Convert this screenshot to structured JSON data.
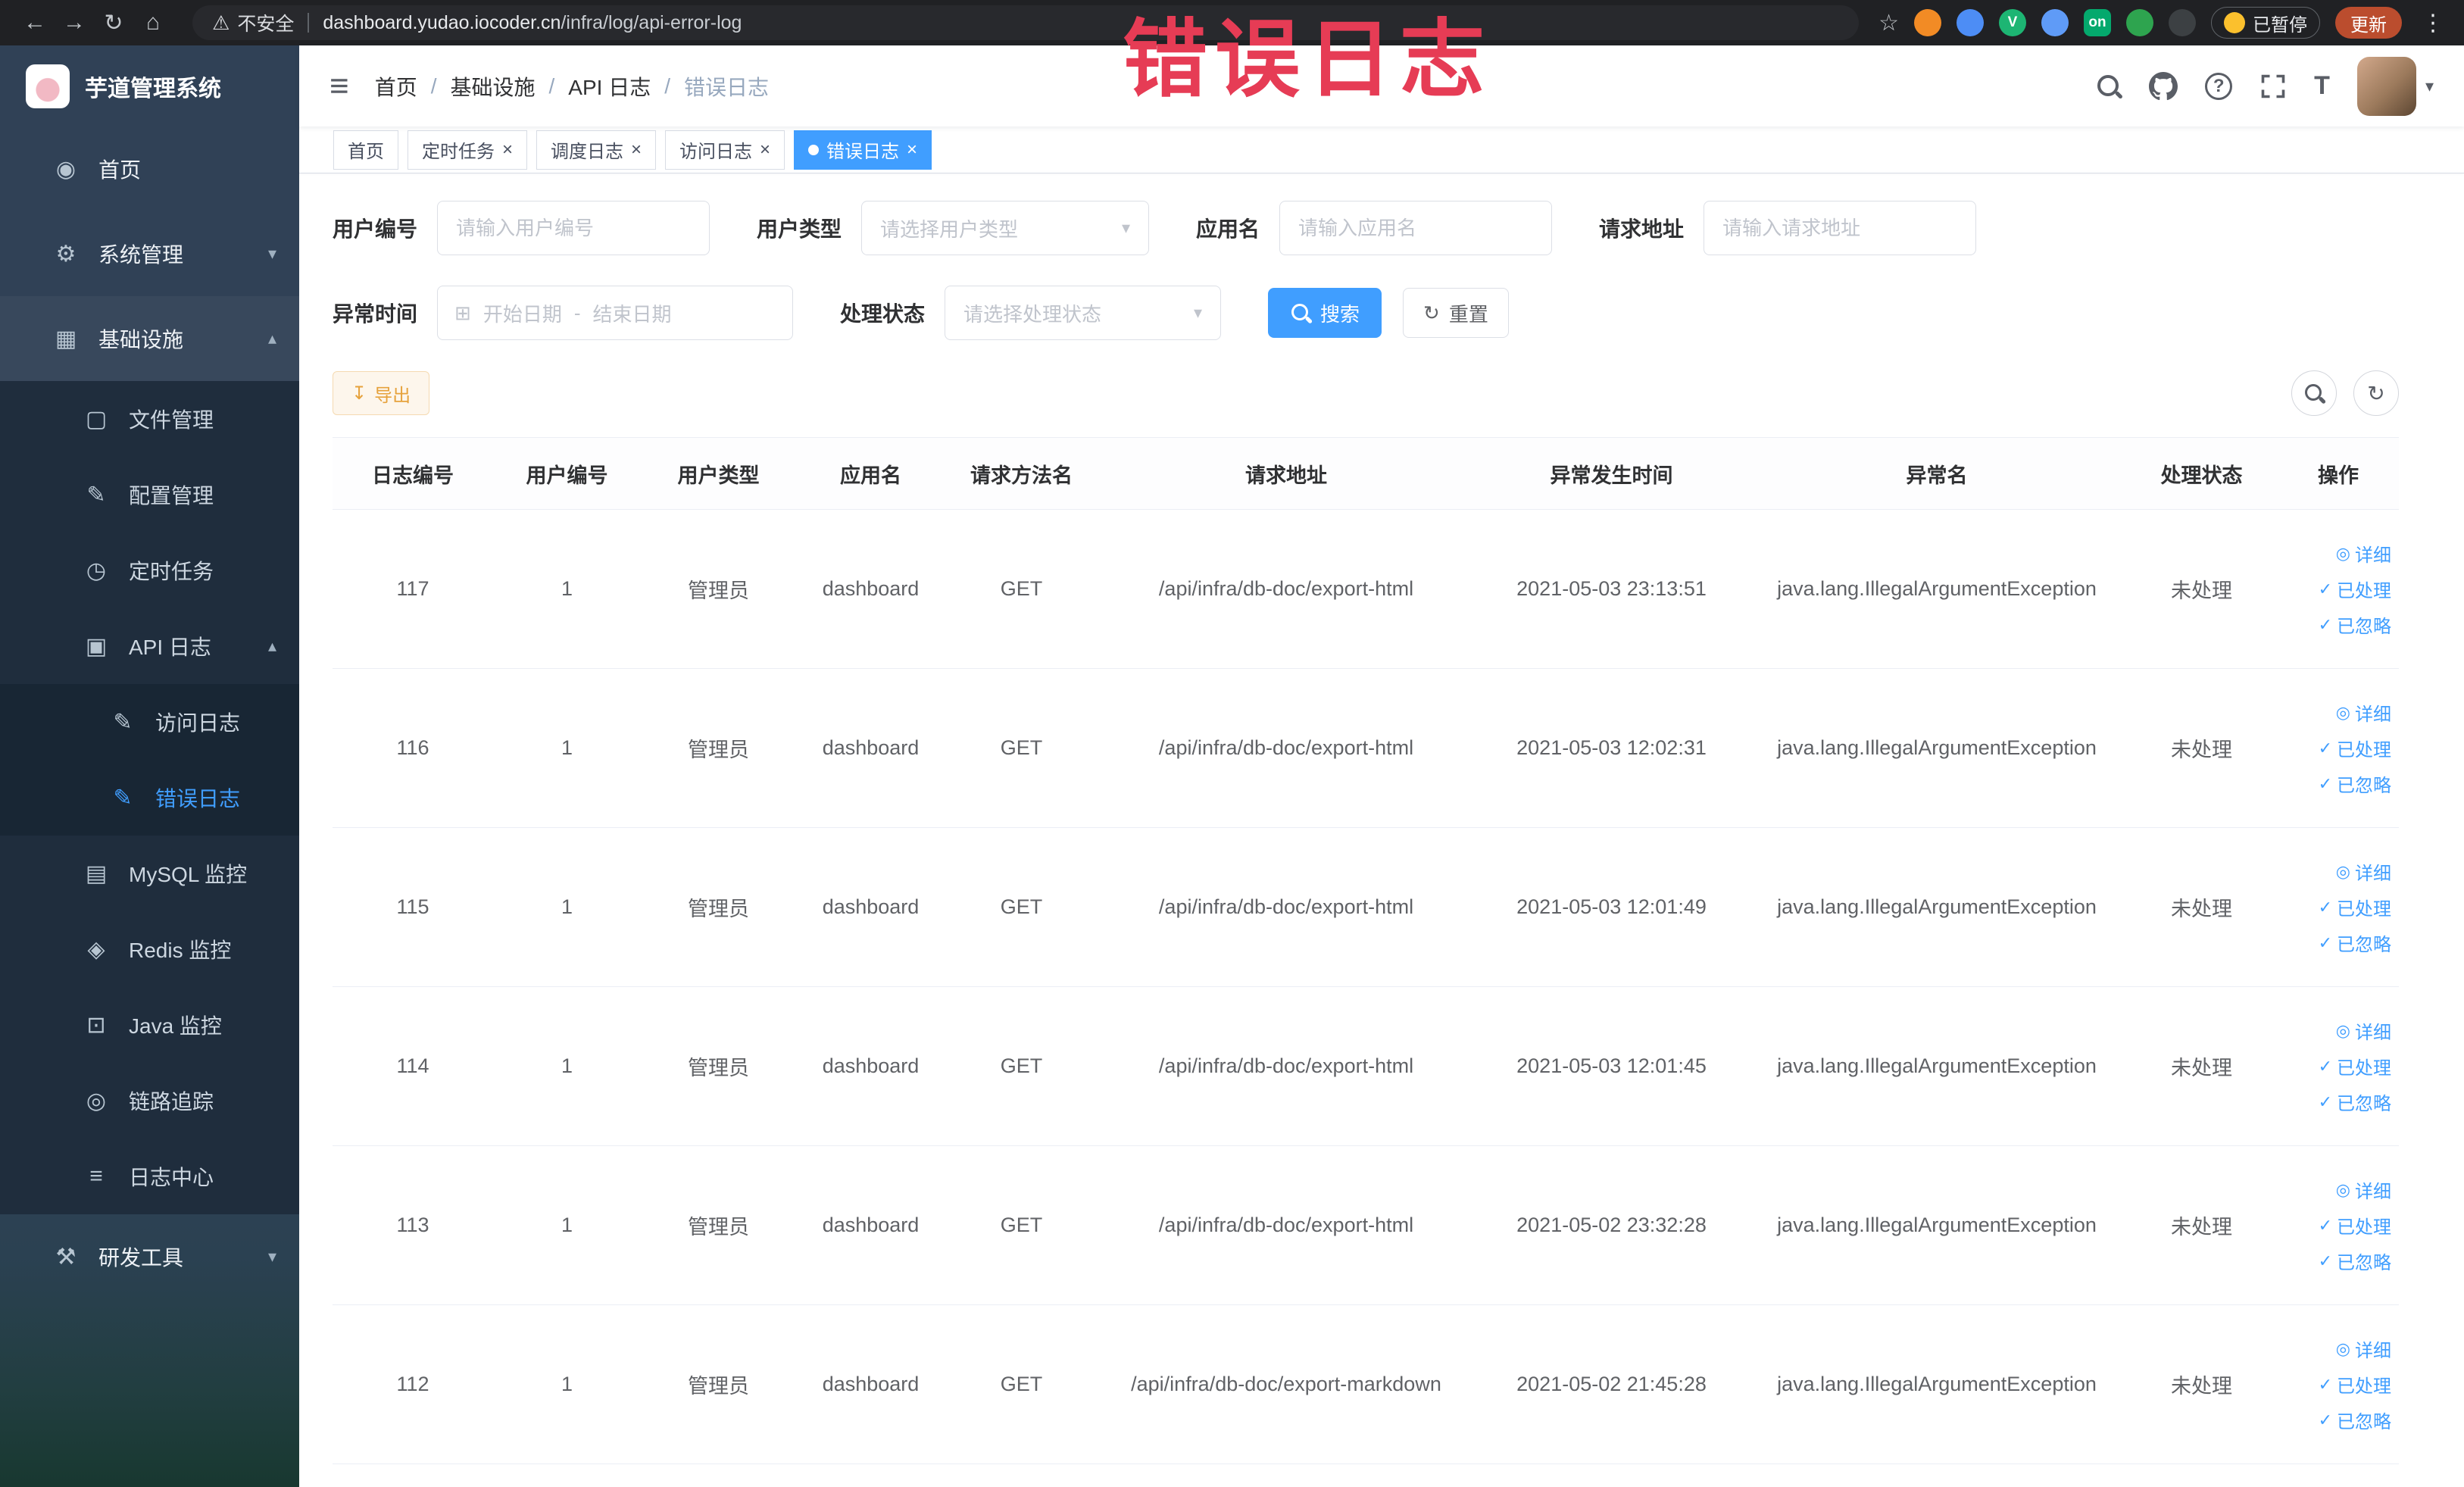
{
  "browser": {
    "security_label": "不安全",
    "url_domain": "dashboard.yudao.iocoder.cn",
    "url_path": "/infra/log/api-error-log",
    "paused_badge": "已暂停",
    "update_label": "更新",
    "ext_on_label": "on",
    "ext_v_label": "V"
  },
  "overlay_text": "错误日志",
  "icons": {
    "back": "←",
    "forward": "→",
    "reload": "↻",
    "home_browser": "⌂",
    "warning": "⚠",
    "star": "☆",
    "kebab": "⋮",
    "hamburger": "≡",
    "question": "?",
    "caret_down": "▾",
    "caret_up": "▴",
    "close": "×",
    "calendar": "⊞",
    "download": "↧",
    "refresh": "↻",
    "check": "✓",
    "detail": "◎",
    "font_size": "T",
    "menu_home": "◉",
    "menu_system": "⚙",
    "menu_infra": "▦",
    "menu_file": "▢",
    "menu_config": "✎",
    "menu_job": "◷",
    "menu_api_log": "▣",
    "menu_access_log": "✎",
    "menu_error_log": "✎",
    "menu_mysql": "▤",
    "menu_redis": "◈",
    "menu_java": "⊡",
    "menu_trace": "◎",
    "menu_log_center": "≡",
    "menu_devtools": "⚒"
  },
  "sidebar": {
    "logo_title": "芋道管理系统",
    "items": {
      "home": "首页",
      "system": "系统管理",
      "infra": "基础设施",
      "file": "文件管理",
      "config": "配置管理",
      "job": "定时任务",
      "api_log": "API 日志",
      "access_log": "访问日志",
      "error_log": "错误日志",
      "mysql": "MySQL 监控",
      "redis": "Redis 监控",
      "java": "Java 监控",
      "trace": "链路追踪",
      "log_center": "日志中心",
      "devtools": "研发工具"
    }
  },
  "header": {
    "breadcrumb": [
      "首页",
      "基础设施",
      "API 日志",
      "错误日志"
    ],
    "separator": "/"
  },
  "tabs": [
    {
      "label": "首页"
    },
    {
      "label": "定时任务"
    },
    {
      "label": "调度日志"
    },
    {
      "label": "访问日志"
    },
    {
      "label": "错误日志"
    }
  ],
  "filters": {
    "user_id_label": "用户编号",
    "user_id_placeholder": "请输入用户编号",
    "user_type_label": "用户类型",
    "user_type_placeholder": "请选择用户类型",
    "app_name_label": "应用名",
    "app_name_placeholder": "请输入应用名",
    "request_url_label": "请求地址",
    "request_url_placeholder": "请输入请求地址",
    "time_label": "异常时间",
    "time_start_placeholder": "开始日期",
    "time_range_separator": "-",
    "time_end_placeholder": "结束日期",
    "status_label": "处理状态",
    "status_placeholder": "请选择处理状态",
    "search_label": "搜索",
    "reset_label": "重置"
  },
  "toolbar": {
    "export_label": "导出"
  },
  "table": {
    "columns": [
      "日志编号",
      "用户编号",
      "用户类型",
      "应用名",
      "请求方法名",
      "请求地址",
      "异常发生时间",
      "异常名",
      "处理状态",
      "操作"
    ],
    "actions": [
      {
        "label": "详细",
        "icon": "detail"
      },
      {
        "label": "已处理",
        "icon": "check"
      },
      {
        "label": "已忽略",
        "icon": "check"
      }
    ],
    "rows": [
      {
        "id": "117",
        "user_id": "1",
        "user_type": "管理员",
        "app": "dashboard",
        "method": "GET",
        "url": "/api/infra/db-doc/export-html",
        "time": "2021-05-03 23:13:51",
        "exception": "java.lang.IllegalArgumentException",
        "status": "未处理"
      },
      {
        "id": "116",
        "user_id": "1",
        "user_type": "管理员",
        "app": "dashboard",
        "method": "GET",
        "url": "/api/infra/db-doc/export-html",
        "time": "2021-05-03 12:02:31",
        "exception": "java.lang.IllegalArgumentException",
        "status": "未处理"
      },
      {
        "id": "115",
        "user_id": "1",
        "user_type": "管理员",
        "app": "dashboard",
        "method": "GET",
        "url": "/api/infra/db-doc/export-html",
        "time": "2021-05-03 12:01:49",
        "exception": "java.lang.IllegalArgumentException",
        "status": "未处理"
      },
      {
        "id": "114",
        "user_id": "1",
        "user_type": "管理员",
        "app": "dashboard",
        "method": "GET",
        "url": "/api/infra/db-doc/export-html",
        "time": "2021-05-03 12:01:45",
        "exception": "java.lang.IllegalArgumentException",
        "status": "未处理"
      },
      {
        "id": "113",
        "user_id": "1",
        "user_type": "管理员",
        "app": "dashboard",
        "method": "GET",
        "url": "/api/infra/db-doc/export-html",
        "time": "2021-05-02 23:32:28",
        "exception": "java.lang.IllegalArgumentException",
        "status": "未处理"
      },
      {
        "id": "112",
        "user_id": "1",
        "user_type": "管理员",
        "app": "dashboard",
        "method": "GET",
        "url": "/api/infra/db-doc/export-markdown",
        "time": "2021-05-02 21:45:28",
        "exception": "java.lang.IllegalArgumentException",
        "status": "未处理"
      }
    ]
  },
  "colors": {
    "primary": "#409EFF",
    "sidebar_bg": "#304156",
    "submenu_bg": "#1f2d3d",
    "annotation_red": "#e63c55",
    "warning": "#e6a23c",
    "active_tab_bg": "#409EFF"
  }
}
